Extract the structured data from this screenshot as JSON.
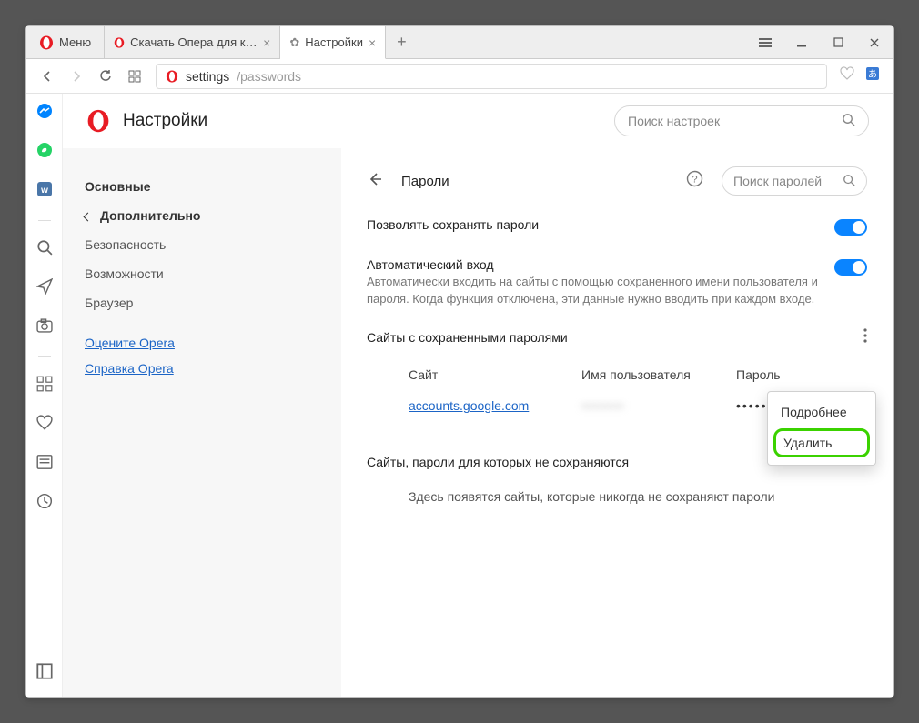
{
  "window": {
    "menu_label": "Меню",
    "tabs": [
      {
        "label": "Скачать Опера для комп..."
      },
      {
        "label": "Настройки"
      }
    ]
  },
  "address": {
    "prefix": "settings",
    "suffix": "/passwords"
  },
  "settings": {
    "title": "Настройки",
    "search_placeholder": "Поиск настроек"
  },
  "sidebar": {
    "basic": "Основные",
    "advanced": "Дополнительно",
    "children": [
      "Безопасность",
      "Возможности",
      "Браузер"
    ],
    "links": [
      "Оцените Opera",
      "Справка Opera"
    ]
  },
  "passwords": {
    "heading": "Пароли",
    "search_placeholder": "Поиск паролей",
    "allow_save": "Позволять сохранять пароли",
    "auto_login": {
      "title": "Автоматический вход",
      "desc": "Автоматически входить на сайты с помощью сохраненного имени пользователя и пароля. Когда функция отключена, эти данные нужно вводить при каждом входе."
    },
    "saved_title": "Сайты с сохраненными паролями",
    "columns": {
      "site": "Сайт",
      "user": "Имя пользователя",
      "pass": "Пароль"
    },
    "saved": [
      {
        "site": "accounts.google.com",
        "user": "••••••••",
        "pass": "••••••••••••"
      }
    ],
    "never_title": "Сайты, пароли для которых не сохраняются",
    "never_empty": "Здесь появятся сайты, которые никогда не сохраняют пароли",
    "menu": {
      "details": "Подробнее",
      "delete": "Удалить"
    }
  }
}
